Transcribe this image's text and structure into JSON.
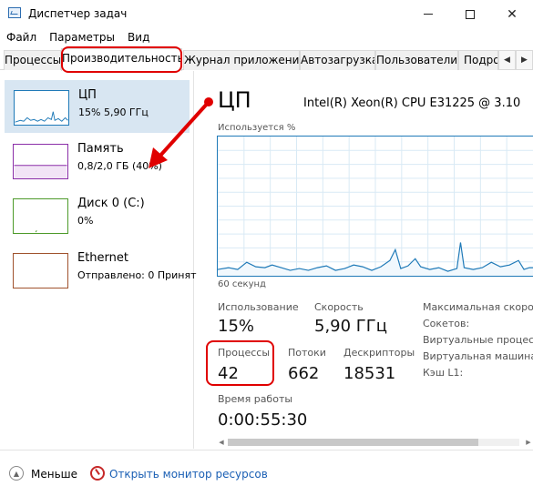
{
  "window": {
    "title": "Диспетчер задач"
  },
  "menu": [
    "Файл",
    "Параметры",
    "Вид"
  ],
  "tabs": [
    {
      "label": "Процессы",
      "active": false
    },
    {
      "label": "Производительность",
      "active": true
    },
    {
      "label": "Журнал приложений",
      "active": false
    },
    {
      "label": "Автозагрузка",
      "active": false
    },
    {
      "label": "Пользователи",
      "active": false
    },
    {
      "label": "Подро",
      "active": false
    }
  ],
  "sidebar": {
    "items": [
      {
        "name": "ЦП",
        "sub": "15% 5,90 ГГц",
        "color": "#1f7ab8"
      },
      {
        "name": "Память",
        "sub": "0,8/2,0 ГБ (40%)",
        "color": "#8b2fa8"
      },
      {
        "name": "Диск 0 (C:)",
        "sub": "0%",
        "color": "#4d9a2a"
      },
      {
        "name": "Ethernet",
        "sub": "Отправлено: 0 Принят",
        "color": "#a0522d"
      }
    ]
  },
  "cpu": {
    "title": "ЦП",
    "model": "Intel(R) Xeon(R) CPU E31225 @ 3.10",
    "graph_caption": "Используется %",
    "graph_footer": "60 секунд",
    "stats": {
      "usage_label": "Использование",
      "usage_value": "15%",
      "speed_label": "Скорость",
      "speed_value": "5,90 ГГц",
      "processes_label": "Процессы",
      "processes_value": "42",
      "threads_label": "Потоки",
      "threads_value": "662",
      "handles_label": "Дескрипторы",
      "handles_value": "18531",
      "uptime_label": "Время работы",
      "uptime_value": "0:00:55:30"
    },
    "details": [
      "Максимальная скоро",
      "Сокетов:",
      "Виртуальные процес",
      "Виртуальная машина",
      "Кэш L1:"
    ]
  },
  "footer": {
    "less_label": "Меньше",
    "monitor_link": "Открыть монитор ресурсов"
  },
  "colors": {
    "accent_red": "#e00000",
    "cpu_blue": "#1f7ab8"
  }
}
